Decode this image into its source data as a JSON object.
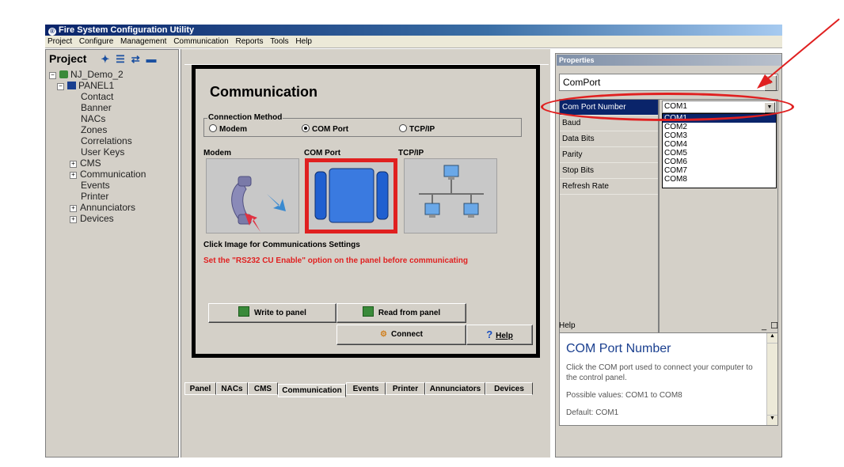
{
  "window": {
    "title": "Fire System Configuration Utility"
  },
  "menu": [
    "Project",
    "Configure",
    "Management",
    "Communication",
    "Reports",
    "Tools",
    "Help"
  ],
  "project": {
    "header": "Project",
    "tree": [
      {
        "label": "NJ_Demo_2",
        "level": 0,
        "expander": "−"
      },
      {
        "label": "PANEL1",
        "level": 1,
        "expander": "−"
      },
      {
        "label": "Contact",
        "level": 2,
        "expander": ""
      },
      {
        "label": "Banner",
        "level": 2,
        "expander": ""
      },
      {
        "label": "NACs",
        "level": 2,
        "expander": ""
      },
      {
        "label": "Zones",
        "level": 2,
        "expander": ""
      },
      {
        "label": "Correlations",
        "level": 2,
        "expander": ""
      },
      {
        "label": "User Keys",
        "level": 2,
        "expander": ""
      },
      {
        "label": "CMS",
        "level": 2,
        "expander": "+"
      },
      {
        "label": "Communication",
        "level": 2,
        "expander": "+"
      },
      {
        "label": "Events",
        "level": 2,
        "expander": ""
      },
      {
        "label": "Printer",
        "level": 2,
        "expander": ""
      },
      {
        "label": "Annunciators",
        "level": 2,
        "expander": "+"
      },
      {
        "label": "Devices",
        "level": 2,
        "expander": "+"
      }
    ]
  },
  "comm": {
    "title": "Communication",
    "connection_legend": "Connection Method",
    "methods": [
      "Modem",
      "COM Port",
      "TCP/IP"
    ],
    "selected_method": "COM Port",
    "columns": [
      "Modem",
      "COM Port",
      "TCP/IP"
    ],
    "click_hint": "Click Image for Communications Settings",
    "warning": "Set the \"RS232 CU Enable\" option on the panel before communicating",
    "write_label": "Write to panel",
    "read_label": "Read from panel",
    "connect_label": "Connect",
    "help_label": "Help"
  },
  "tabs": [
    "Panel",
    "NACs",
    "CMS",
    "Communication",
    "Events",
    "Printer",
    "Annunciators",
    "Devices"
  ],
  "active_tab": "Communication",
  "properties": {
    "header": "Properties",
    "object": "ComPort",
    "rows": [
      "Com Port Number",
      "Baud",
      "Data Bits",
      "Parity",
      "Stop Bits",
      "Refresh Rate"
    ],
    "selected_row": "Com Port Number",
    "com_value": "COM1",
    "com_options": [
      "COM1",
      "COM2",
      "COM3",
      "COM4",
      "COM5",
      "COM6",
      "COM7",
      "COM8"
    ]
  },
  "help": {
    "header": "Help",
    "title": "COM Port Number",
    "lines": [
      "Click the COM port used to connect your computer to the control panel.",
      "Possible values: COM1 to COM8",
      "Default: COM1"
    ]
  },
  "colors": {
    "annotation": "#e02020",
    "selection": "#0a246a"
  }
}
